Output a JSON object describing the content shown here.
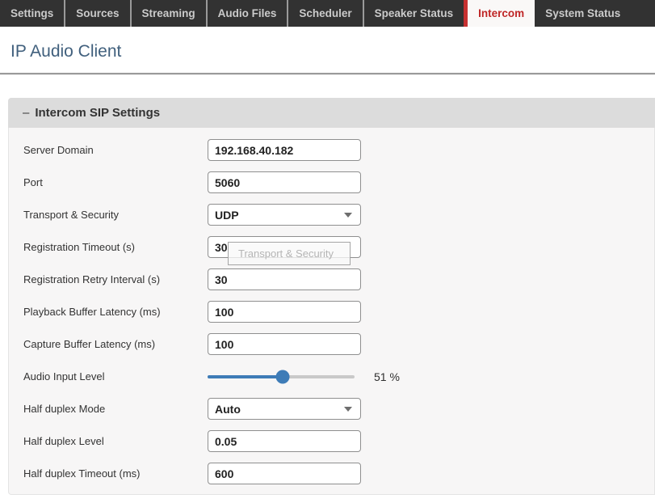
{
  "tabs": {
    "items": [
      {
        "label": "Settings",
        "active": false
      },
      {
        "label": "Sources",
        "active": false
      },
      {
        "label": "Streaming",
        "active": false
      },
      {
        "label": "Audio Files",
        "active": false
      },
      {
        "label": "Scheduler",
        "active": false
      },
      {
        "label": "Speaker Status",
        "active": false
      },
      {
        "label": "Intercom",
        "active": true
      },
      {
        "label": "System Status",
        "active": false
      }
    ]
  },
  "page": {
    "title": "IP Audio Client"
  },
  "panel": {
    "collapse_indicator": "–",
    "title": "Intercom SIP Settings",
    "fields": [
      {
        "label": "Server Domain",
        "type": "text",
        "value": "192.168.40.182"
      },
      {
        "label": "Port",
        "type": "text",
        "value": "5060"
      },
      {
        "label": "Transport & Security",
        "type": "select",
        "value": "UDP"
      },
      {
        "label": "Registration Timeout (s)",
        "type": "text",
        "value": "30",
        "tooltip": "Transport & Security"
      },
      {
        "label": "Registration Retry Interval (s)",
        "type": "text",
        "value": "30"
      },
      {
        "label": "Playback Buffer Latency (ms)",
        "type": "text",
        "value": "100"
      },
      {
        "label": "Capture Buffer Latency (ms)",
        "type": "text",
        "value": "100"
      },
      {
        "label": "Audio Input Level",
        "type": "slider",
        "percent": 51,
        "display": "51 %"
      },
      {
        "label": "Half duplex Mode",
        "type": "select",
        "value": "Auto"
      },
      {
        "label": "Half duplex Level",
        "type": "text",
        "value": "0.05"
      },
      {
        "label": "Half duplex Timeout (ms)",
        "type": "text",
        "value": "600"
      }
    ]
  },
  "colors": {
    "tabbar_bg": "#323232",
    "tab_text": "#cbcbcb",
    "active_tab_bg": "#faf8f7",
    "active_tab_text": "#bf2626",
    "active_tab_border": "#c63131",
    "title_text": "#41607d",
    "panel_header_bg": "#dcdcdc",
    "panel_body_bg": "#f7f6f6",
    "input_border": "#8f8f8f",
    "slider_blue": "#3e7cb7",
    "slider_track": "#c9c9c9",
    "tooltip_text": "#b5b5b5"
  }
}
